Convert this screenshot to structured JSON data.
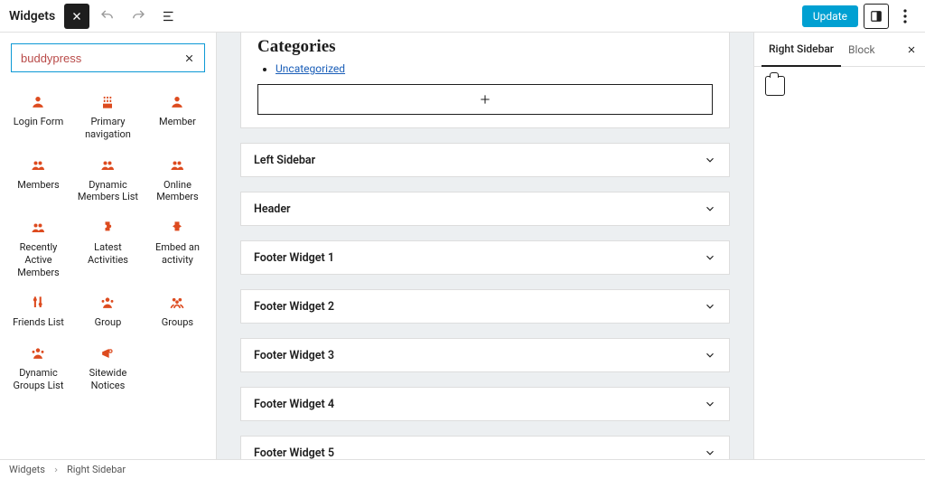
{
  "topbar": {
    "title": "Widgets",
    "update_label": "Update"
  },
  "search": {
    "value": "buddypress"
  },
  "blocks": [
    {
      "icon": "user",
      "label": "Login Form"
    },
    {
      "icon": "cake",
      "label": "Primary navigation"
    },
    {
      "icon": "user",
      "label": "Member"
    },
    {
      "icon": "users",
      "label": "Members"
    },
    {
      "icon": "users",
      "label": "Dynamic Members List"
    },
    {
      "icon": "users",
      "label": "Online Members"
    },
    {
      "icon": "users",
      "label": "Recently Active Members"
    },
    {
      "icon": "puzzle",
      "label": "Latest Activities"
    },
    {
      "icon": "embed",
      "label": "Embed an activity"
    },
    {
      "icon": "sliders",
      "label": "Friends List"
    },
    {
      "icon": "group",
      "label": "Group"
    },
    {
      "icon": "groups",
      "label": "Groups"
    },
    {
      "icon": "group",
      "label": "Dynamic Groups List"
    },
    {
      "icon": "megaphone",
      "label": "Sitewide Notices"
    }
  ],
  "center": {
    "categories_heading": "Categories",
    "category_link": "Uncategorized",
    "areas": [
      "Left Sidebar",
      "Header",
      "Footer Widget 1",
      "Footer Widget 2",
      "Footer Widget 3",
      "Footer Widget 4",
      "Footer Widget 5"
    ]
  },
  "right": {
    "tab_area": "Right Sidebar",
    "tab_block": "Block"
  },
  "breadcrumb": {
    "root": "Widgets",
    "current": "Right Sidebar"
  }
}
